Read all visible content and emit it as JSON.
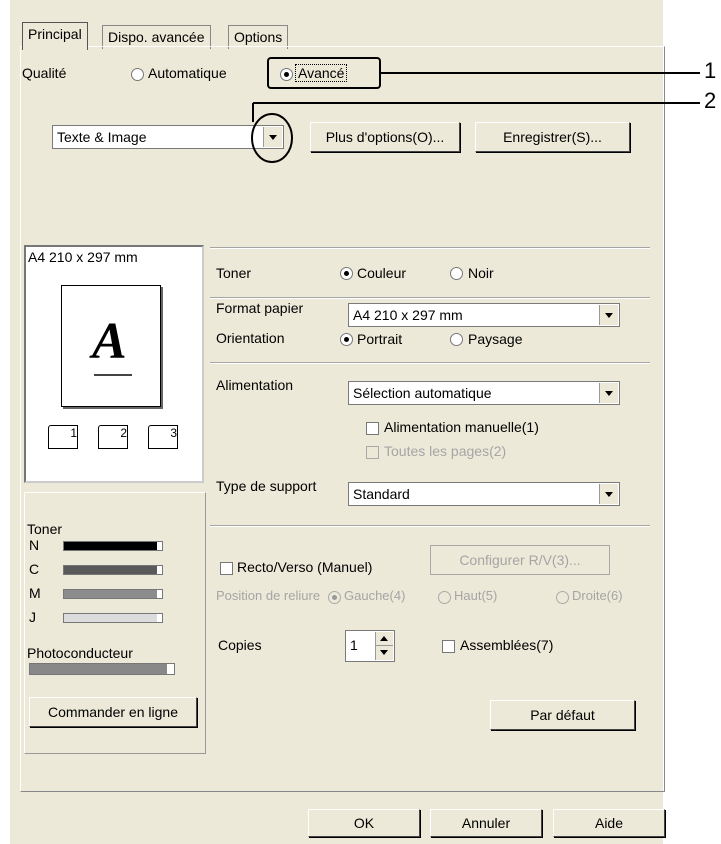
{
  "tabs": [
    "Principal",
    "Dispo. avancée",
    "Options"
  ],
  "quality": {
    "label": "Qualité",
    "auto": "Automatique",
    "advanced": "Avancé",
    "selected": "advanced",
    "preset": "Texte & Image",
    "more_options": "Plus d'options(O)...",
    "save": "Enregistrer(S)..."
  },
  "callouts": [
    "1",
    "2"
  ],
  "preview": {
    "paper_label": "A4 210 x 297 mm",
    "letter": "A",
    "icons": [
      "1",
      "2",
      "3"
    ]
  },
  "status": {
    "toner_label": "Toner",
    "levels": [
      {
        "code": "N",
        "level": 0.95,
        "color": "#000000"
      },
      {
        "code": "C",
        "level": 0.95,
        "color": "#5a5a5a"
      },
      {
        "code": "M",
        "level": 0.95,
        "color": "#8c8c8c"
      },
      {
        "code": "J",
        "level": 0.95,
        "color": "#dcdcdc"
      }
    ],
    "photo_label": "Photoconducteur",
    "photo_level": 0.95,
    "order_button": "Commander en ligne"
  },
  "settings": {
    "toner_label": "Toner",
    "color": "Couleur",
    "black": "Noir",
    "toner_selected": "color",
    "paper_format_label": "Format papier",
    "paper_format_value": "A4 210 x 297 mm",
    "orientation_label": "Orientation",
    "portrait": "Portrait",
    "landscape": "Paysage",
    "orientation_selected": "portrait",
    "feed_label": "Alimentation",
    "feed_value": "Sélection automatique",
    "manual_feed": "Alimentation manuelle(1)",
    "all_pages": "Toutes les pages(2)",
    "media_label": "Type de support",
    "media_value": "Standard",
    "duplex": "Recto/Verso (Manuel)",
    "duplex_config": "Configurer R/V(3)...",
    "binding_label": "Position de reliure",
    "left": "Gauche(4)",
    "top": "Haut(5)",
    "right": "Droite(6)",
    "copies_label": "Copies",
    "copies_value": "1",
    "collate": "Assemblées(7)",
    "default_button": "Par défaut"
  },
  "footer": {
    "ok": "OK",
    "cancel": "Annuler",
    "help": "Aide"
  }
}
